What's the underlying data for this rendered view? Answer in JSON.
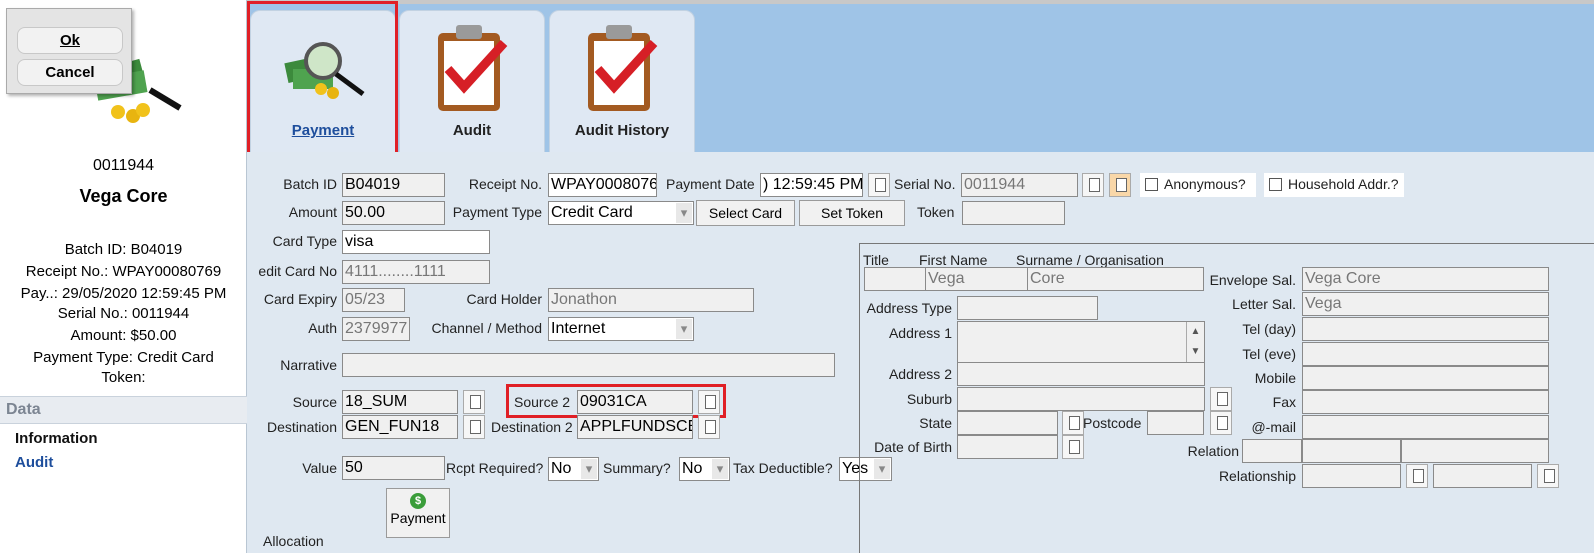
{
  "left": {
    "ok_label": "Ok",
    "cancel_label": "Cancel",
    "id": "0011944",
    "name": "Vega Core",
    "summary": [
      "Batch ID: B04019",
      "Receipt No.: WPAY00080769",
      "Pay..: 29/05/2020 12:59:45 PM",
      "Serial No.: 0011944",
      "Amount: $50.00",
      "Payment Type: Credit Card",
      "Token:"
    ],
    "data_header": "Data",
    "nav": [
      "Information",
      "Audit"
    ]
  },
  "tabs": [
    {
      "label": "Payment",
      "icon": "money-magnifier-icon"
    },
    {
      "label": "Audit",
      "icon": "clipboard-check-icon"
    },
    {
      "label": "Audit History",
      "icon": "clipboard-check-icon"
    }
  ],
  "form": {
    "labels": {
      "batch_id": "Batch ID",
      "receipt_no": "Receipt No.",
      "payment_date": "Payment Date",
      "serial_no": "Serial No.",
      "anonymous": "Anonymous?",
      "household": "Household Addr.?",
      "amount": "Amount",
      "payment_type": "Payment Type",
      "token": "Token",
      "card_type": "Card Type",
      "card_no": "edit Card No",
      "card_expiry": "Card Expiry",
      "card_holder": "Card Holder",
      "auth": "Auth",
      "channel": "Channel / Method",
      "narrative": "Narrative",
      "source": "Source",
      "source2": "Source 2",
      "destination": "Destination",
      "destination2": "Destination 2",
      "value": "Value",
      "rcpt_required": "Rcpt Required?",
      "summary": "Summary?",
      "tax_deductible": "Tax Deductible?",
      "allocation": "Allocation"
    },
    "values": {
      "batch_id": "B04019",
      "receipt_no": "WPAY0008076",
      "payment_date": ") 12:59:45 PM",
      "serial_no": "0011944",
      "amount": "50.00",
      "payment_type": "Credit Card",
      "token": "",
      "card_type": "visa",
      "card_no": "4111........1111",
      "card_expiry": "05/23",
      "card_holder": "Jonathon",
      "auth": "2379977",
      "channel": "Internet",
      "narrative": "",
      "source": "18_SUM",
      "source2": "09031CA",
      "destination": "GEN_FUN18",
      "destination2": "APPLFUNDSCE",
      "value": "50",
      "rcpt_required": "No",
      "summary": "No",
      "tax_deductible": "Yes"
    },
    "buttons": {
      "select_card": "Select Card",
      "set_token": "Set Token",
      "payment": "Payment"
    }
  },
  "contact": {
    "headers": {
      "title": "Title",
      "first_name": "First Name",
      "surname": "Surname / Organisation"
    },
    "values": {
      "title": "",
      "first_name": "Vega",
      "surname": "Core",
      "envelope_sal": "Vega Core",
      "letter_sal": "Vega"
    },
    "labels": {
      "address_type": "Address Type",
      "address1": "Address 1",
      "address2": "Address 2",
      "suburb": "Suburb",
      "state": "State",
      "postcode": "Postcode",
      "dob": "Date of Birth",
      "envelope_sal": "Envelope Sal.",
      "letter_sal": "Letter Sal.",
      "tel_day": "Tel (day)",
      "tel_eve": "Tel (eve)",
      "mobile": "Mobile",
      "fax": "Fax",
      "email": "@-mail",
      "relation": "Relation",
      "relationship": "Relationship"
    }
  },
  "colors": {
    "accent_red": "#e01f26",
    "tab_bar": "#9fc4e7",
    "nav_blue": "#1e4e9c"
  }
}
